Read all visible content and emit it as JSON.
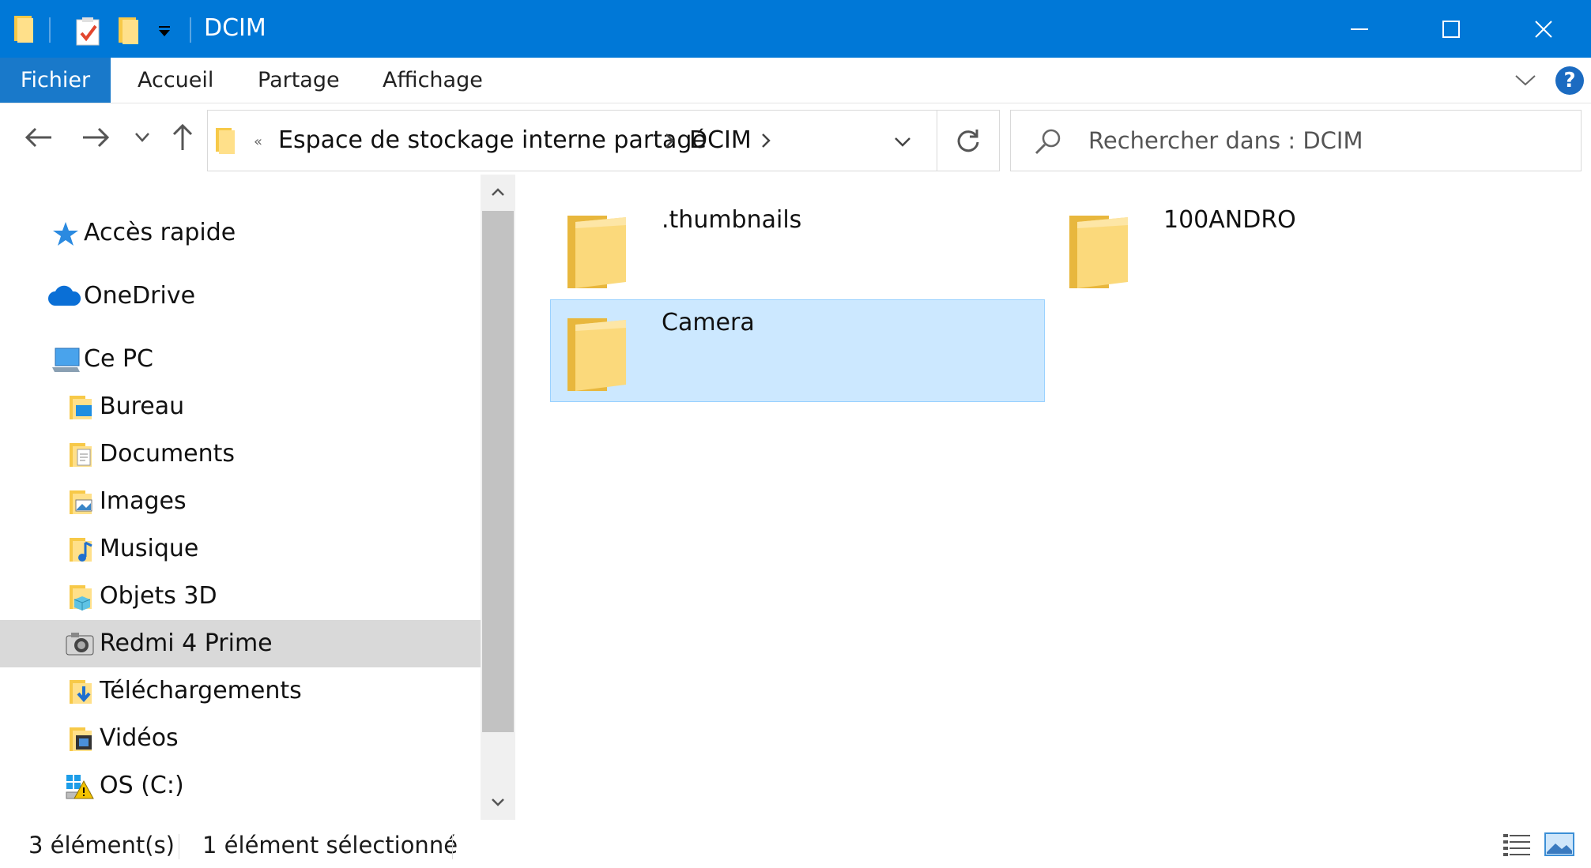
{
  "window": {
    "title": "DCIM",
    "accent": "#0078d7"
  },
  "ribbon": {
    "tabs": [
      {
        "label": "Fichier"
      },
      {
        "label": "Accueil"
      },
      {
        "label": "Partage"
      },
      {
        "label": "Affichage"
      }
    ],
    "help_label": "?"
  },
  "address": {
    "overflow_chevron": "«",
    "segments": [
      "Espace de stockage interne partagé",
      "DCIM"
    ]
  },
  "search": {
    "placeholder": "Rechercher dans : DCIM"
  },
  "navpane": {
    "items": [
      {
        "label": "Accès rapide",
        "icon": "star-icon"
      },
      {
        "label": "OneDrive",
        "icon": "cloud-icon"
      },
      {
        "label": "Ce PC",
        "icon": "computer-icon"
      },
      {
        "label": "Bureau",
        "icon": "desktop-folder-icon"
      },
      {
        "label": "Documents",
        "icon": "documents-folder-icon"
      },
      {
        "label": "Images",
        "icon": "pictures-folder-icon"
      },
      {
        "label": "Musique",
        "icon": "music-folder-icon"
      },
      {
        "label": "Objets 3D",
        "icon": "3d-objects-folder-icon"
      },
      {
        "label": "Redmi 4 Prime",
        "icon": "camera-device-icon",
        "selected": true
      },
      {
        "label": "Téléchargements",
        "icon": "downloads-folder-icon"
      },
      {
        "label": "Vidéos",
        "icon": "videos-folder-icon"
      },
      {
        "label": "OS (C:)",
        "icon": "drive-icon"
      }
    ]
  },
  "content": {
    "folders": [
      {
        "name": ".thumbnails",
        "selected": false
      },
      {
        "name": "100ANDRO",
        "selected": false
      },
      {
        "name": "Camera",
        "selected": true
      }
    ]
  },
  "status": {
    "item_count": "3 élément(s)",
    "selection": "1 élément sélectionné"
  }
}
